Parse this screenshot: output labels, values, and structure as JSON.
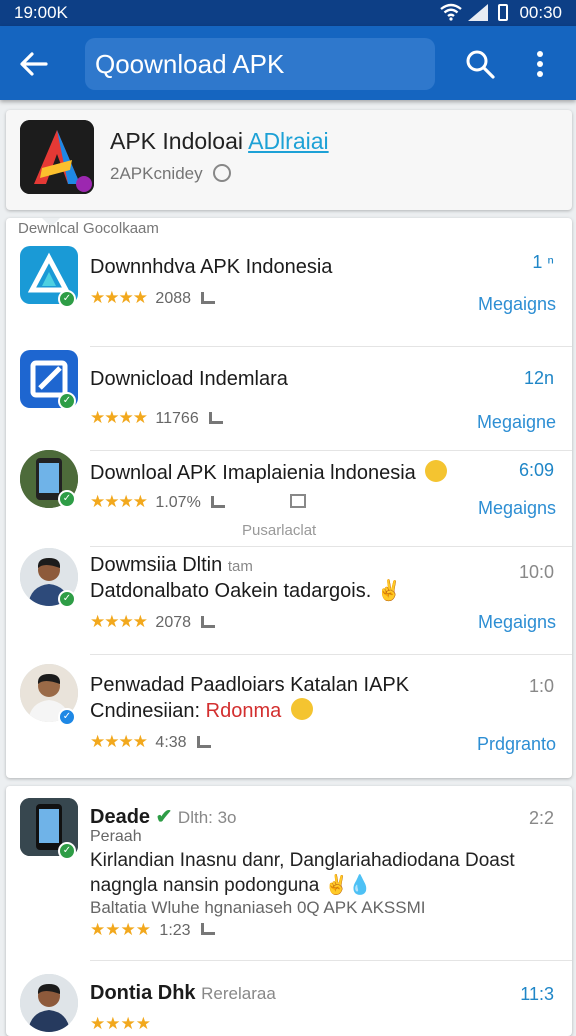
{
  "status_bar": {
    "time_left": "19:00K",
    "time_right": "00:30"
  },
  "app_bar": {
    "search_text": "Qoownload APK"
  },
  "header": {
    "title": "APK Indoloai",
    "title_accent": "ADlraiai",
    "subtitle": "2APKcnidey"
  },
  "list": {
    "section_label": "Dewnlcal Gocolkaam",
    "items": [
      {
        "name": "Downnhdva APK Indonesia",
        "rating": "★★★★",
        "count": "2088",
        "time": "1 ⁿ",
        "action": "Megaigns"
      },
      {
        "name": "Downicload Indemlara",
        "rating": "★★★★",
        "count": "11766",
        "time": "12n",
        "action": "Megaigne"
      },
      {
        "name": "Downloal APK Imaplaienia lndonesia",
        "rating": "★★★★",
        "count": "1.07%",
        "time": "6:09",
        "action": "Megaigns",
        "overlay": "Pusarlaclat"
      },
      {
        "name": "Dowmsiia Dltin",
        "name_suffix": "tam",
        "line2": "Datdonalbato Oakein tadargois.",
        "rating": "★★★★",
        "count": "2078",
        "time": "10:0",
        "action": "Megaigns"
      },
      {
        "name": "Penwadad Paadloiars Katalan IAPK",
        "line2": "Cndinesiian:",
        "line2_red": "Rdonma",
        "rating": "★★★★",
        "count": "4:38",
        "time": "1:0",
        "action": "Prdgranto"
      }
    ]
  },
  "lower": {
    "item1": {
      "name": "Deade",
      "name_rest": "Dlth: 3o",
      "subtitle": "Peraah",
      "body": "Kirlandian Inasnu danr, Danglariahadiodana Doast nagngla nansin podonguna",
      "footer": "Baltatia Wluhe hgnaniaseh 0Q APK AKSSMI",
      "rating": "★★★★",
      "count": "1:23",
      "time": "2:2"
    },
    "item2": {
      "name": "Dontia Dhk",
      "name_rest": "Rerelaraa",
      "time": "11:3",
      "rating": "★★★★"
    }
  },
  "colors": {
    "app_bar": "#1565c0",
    "status_bar": "#0d3f86",
    "accent_link": "#1f86c7",
    "star": "#f2a81d"
  }
}
